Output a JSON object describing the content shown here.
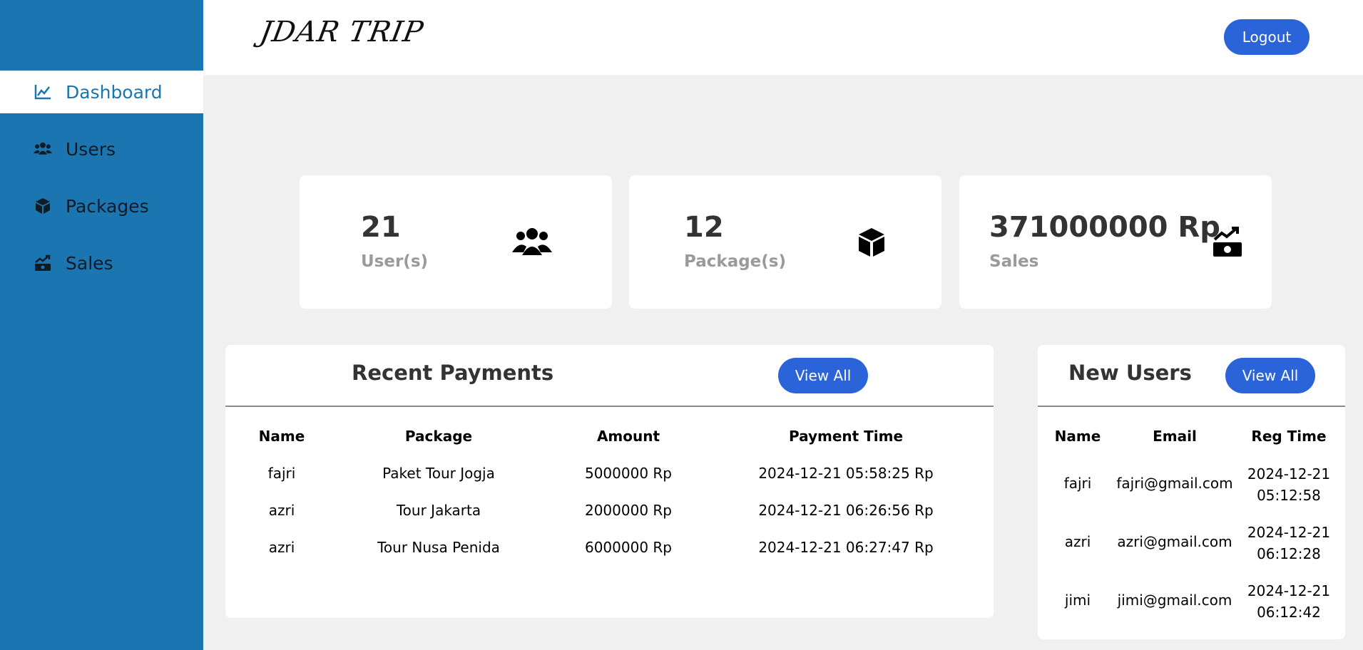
{
  "logo_text": "JDAR TRIP",
  "colors": {
    "sidebar": "#1b75b1",
    "accent_button": "#2b63d9",
    "active_text": "#1b75b1",
    "background": "#f0f0f0"
  },
  "sidebar": {
    "items": [
      {
        "label": "Dashboard",
        "icon": "line-chart-icon",
        "active": true
      },
      {
        "label": "Users",
        "icon": "users-icon",
        "active": false
      },
      {
        "label": "Packages",
        "icon": "box-icon",
        "active": false
      },
      {
        "label": "Sales",
        "icon": "money-chart-icon",
        "active": false
      }
    ]
  },
  "header": {
    "logout_label": "Logout"
  },
  "stats": [
    {
      "value": "21",
      "label": "User(s)",
      "icon": "users-icon"
    },
    {
      "value": "12",
      "label": "Package(s)",
      "icon": "box-icon"
    },
    {
      "value": "371000000 Rp",
      "label": "Sales",
      "icon": "money-chart-icon"
    }
  ],
  "recent_payments": {
    "title": "Recent Payments",
    "view_all_label": "View All",
    "columns": [
      "Name",
      "Package",
      "Amount",
      "Payment Time"
    ],
    "rows": [
      [
        "fajri",
        "Paket Tour Jogja",
        "5000000 Rp",
        "2024-12-21 05:58:25 Rp"
      ],
      [
        "azri",
        "Tour Jakarta",
        "2000000 Rp",
        "2024-12-21 06:26:56 Rp"
      ],
      [
        "azri",
        "Tour Nusa Penida",
        "6000000 Rp",
        "2024-12-21 06:27:47 Rp"
      ]
    ]
  },
  "new_users": {
    "title": "New Users",
    "view_all_label": "View All",
    "columns": [
      "Name",
      "Email",
      "Reg Time"
    ],
    "rows": [
      [
        "fajri",
        "fajri@gmail.com",
        "2024-12-21 05:12:58"
      ],
      [
        "azri",
        "azri@gmail.com",
        "2024-12-21 06:12:28"
      ],
      [
        "jimi",
        "jimi@gmail.com",
        "2024-12-21 06:12:42"
      ]
    ]
  }
}
